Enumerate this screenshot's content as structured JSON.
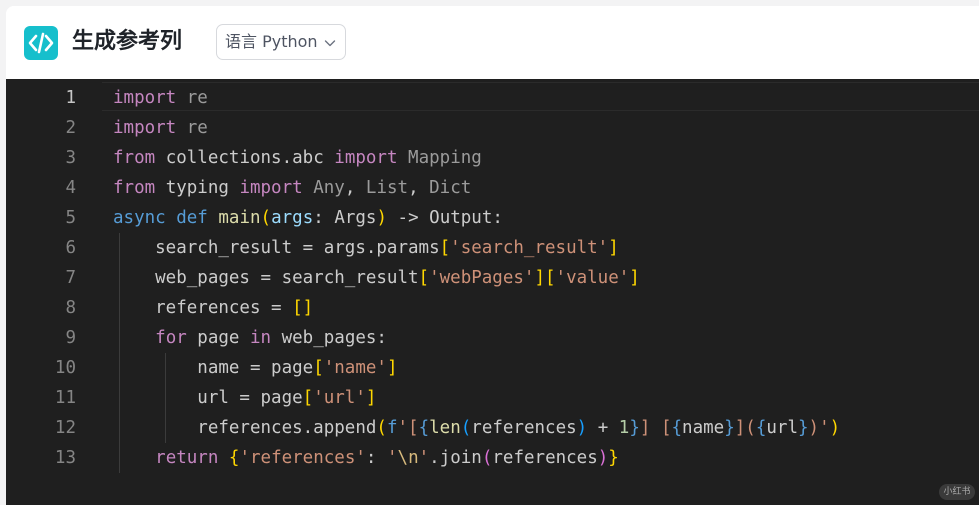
{
  "header": {
    "title": "生成参考列",
    "language_label": "语言 Python",
    "logo_icon": "code-brackets-icon",
    "accent_color": "#16bfcc"
  },
  "editor": {
    "active_line": 1,
    "line_numbers": [
      "1",
      "2",
      "3",
      "4",
      "5",
      "6",
      "7",
      "8",
      "9",
      "10",
      "11",
      "12",
      "13"
    ],
    "lines": [
      [
        [
          "kw",
          "import"
        ],
        [
          "pl",
          " "
        ],
        [
          "dim",
          "re"
        ]
      ],
      [
        [
          "kw",
          "import"
        ],
        [
          "pl",
          " "
        ],
        [
          "dim",
          "re"
        ]
      ],
      [
        [
          "kw",
          "from"
        ],
        [
          "pl",
          " collections.abc "
        ],
        [
          "kw",
          "import"
        ],
        [
          "pl",
          " "
        ],
        [
          "dim",
          "Mapping"
        ]
      ],
      [
        [
          "kw",
          "from"
        ],
        [
          "pl",
          " typing "
        ],
        [
          "kw",
          "import"
        ],
        [
          "pl",
          " "
        ],
        [
          "dim",
          "Any"
        ],
        [
          "pl",
          ", "
        ],
        [
          "dim",
          "List"
        ],
        [
          "pl",
          ", "
        ],
        [
          "dim",
          "Dict"
        ]
      ],
      [
        [
          "kb",
          "async"
        ],
        [
          "pl",
          " "
        ],
        [
          "kb",
          "def"
        ],
        [
          "pl",
          " "
        ],
        [
          "fn",
          "main"
        ],
        [
          "br1",
          "("
        ],
        [
          "vr",
          "args"
        ],
        [
          "pl",
          ": Args"
        ],
        [
          "br1",
          ")"
        ],
        [
          "pl",
          " -> Output:"
        ]
      ],
      [
        [
          "pl",
          "    search_result = args.params"
        ],
        [
          "br1",
          "["
        ],
        [
          "st",
          "'search_result'"
        ],
        [
          "br1",
          "]"
        ]
      ],
      [
        [
          "pl",
          "    web_pages = search_result"
        ],
        [
          "br1",
          "["
        ],
        [
          "st",
          "'webPages'"
        ],
        [
          "br1",
          "]["
        ],
        [
          "st",
          "'value'"
        ],
        [
          "br1",
          "]"
        ]
      ],
      [
        [
          "pl",
          "    references = "
        ],
        [
          "br1",
          "[]"
        ]
      ],
      [
        [
          "pl",
          "    "
        ],
        [
          "kw",
          "for"
        ],
        [
          "pl",
          " page "
        ],
        [
          "kw",
          "in"
        ],
        [
          "pl",
          " web_pages:"
        ]
      ],
      [
        [
          "pl",
          "        name = page"
        ],
        [
          "br1",
          "["
        ],
        [
          "st",
          "'name'"
        ],
        [
          "br1",
          "]"
        ]
      ],
      [
        [
          "pl",
          "        url = page"
        ],
        [
          "br1",
          "["
        ],
        [
          "st",
          "'url'"
        ],
        [
          "br1",
          "]"
        ]
      ],
      [
        [
          "pl",
          "        references.append"
        ],
        [
          "br1",
          "("
        ],
        [
          "kb",
          "f"
        ],
        [
          "st",
          "'["
        ],
        [
          "kb",
          "{"
        ],
        [
          "fn",
          "len"
        ],
        [
          "br3",
          "("
        ],
        [
          "pl",
          "references"
        ],
        [
          "br3",
          ")"
        ],
        [
          "pl",
          " + "
        ],
        [
          "nu",
          "1"
        ],
        [
          "kb",
          "}"
        ],
        [
          "st",
          "] ["
        ],
        [
          "kb",
          "{"
        ],
        [
          "pl",
          "name"
        ],
        [
          "kb",
          "}"
        ],
        [
          "st",
          "]("
        ],
        [
          "kb",
          "{"
        ],
        [
          "pl",
          "url"
        ],
        [
          "kb",
          "}"
        ],
        [
          "st",
          ")'"
        ],
        [
          "br1",
          ")"
        ]
      ],
      [
        [
          "pl",
          "    "
        ],
        [
          "kw",
          "return"
        ],
        [
          "pl",
          " "
        ],
        [
          "br1",
          "{"
        ],
        [
          "st",
          "'references'"
        ],
        [
          "pl",
          ": "
        ],
        [
          "st",
          "'"
        ],
        [
          "es",
          "\\n"
        ],
        [
          "st",
          "'"
        ],
        [
          "pl",
          ".join"
        ],
        [
          "br2",
          "("
        ],
        [
          "pl",
          "references"
        ],
        [
          "br2",
          ")"
        ],
        [
          "br1",
          "}"
        ]
      ]
    ]
  },
  "watermark": "小红书"
}
